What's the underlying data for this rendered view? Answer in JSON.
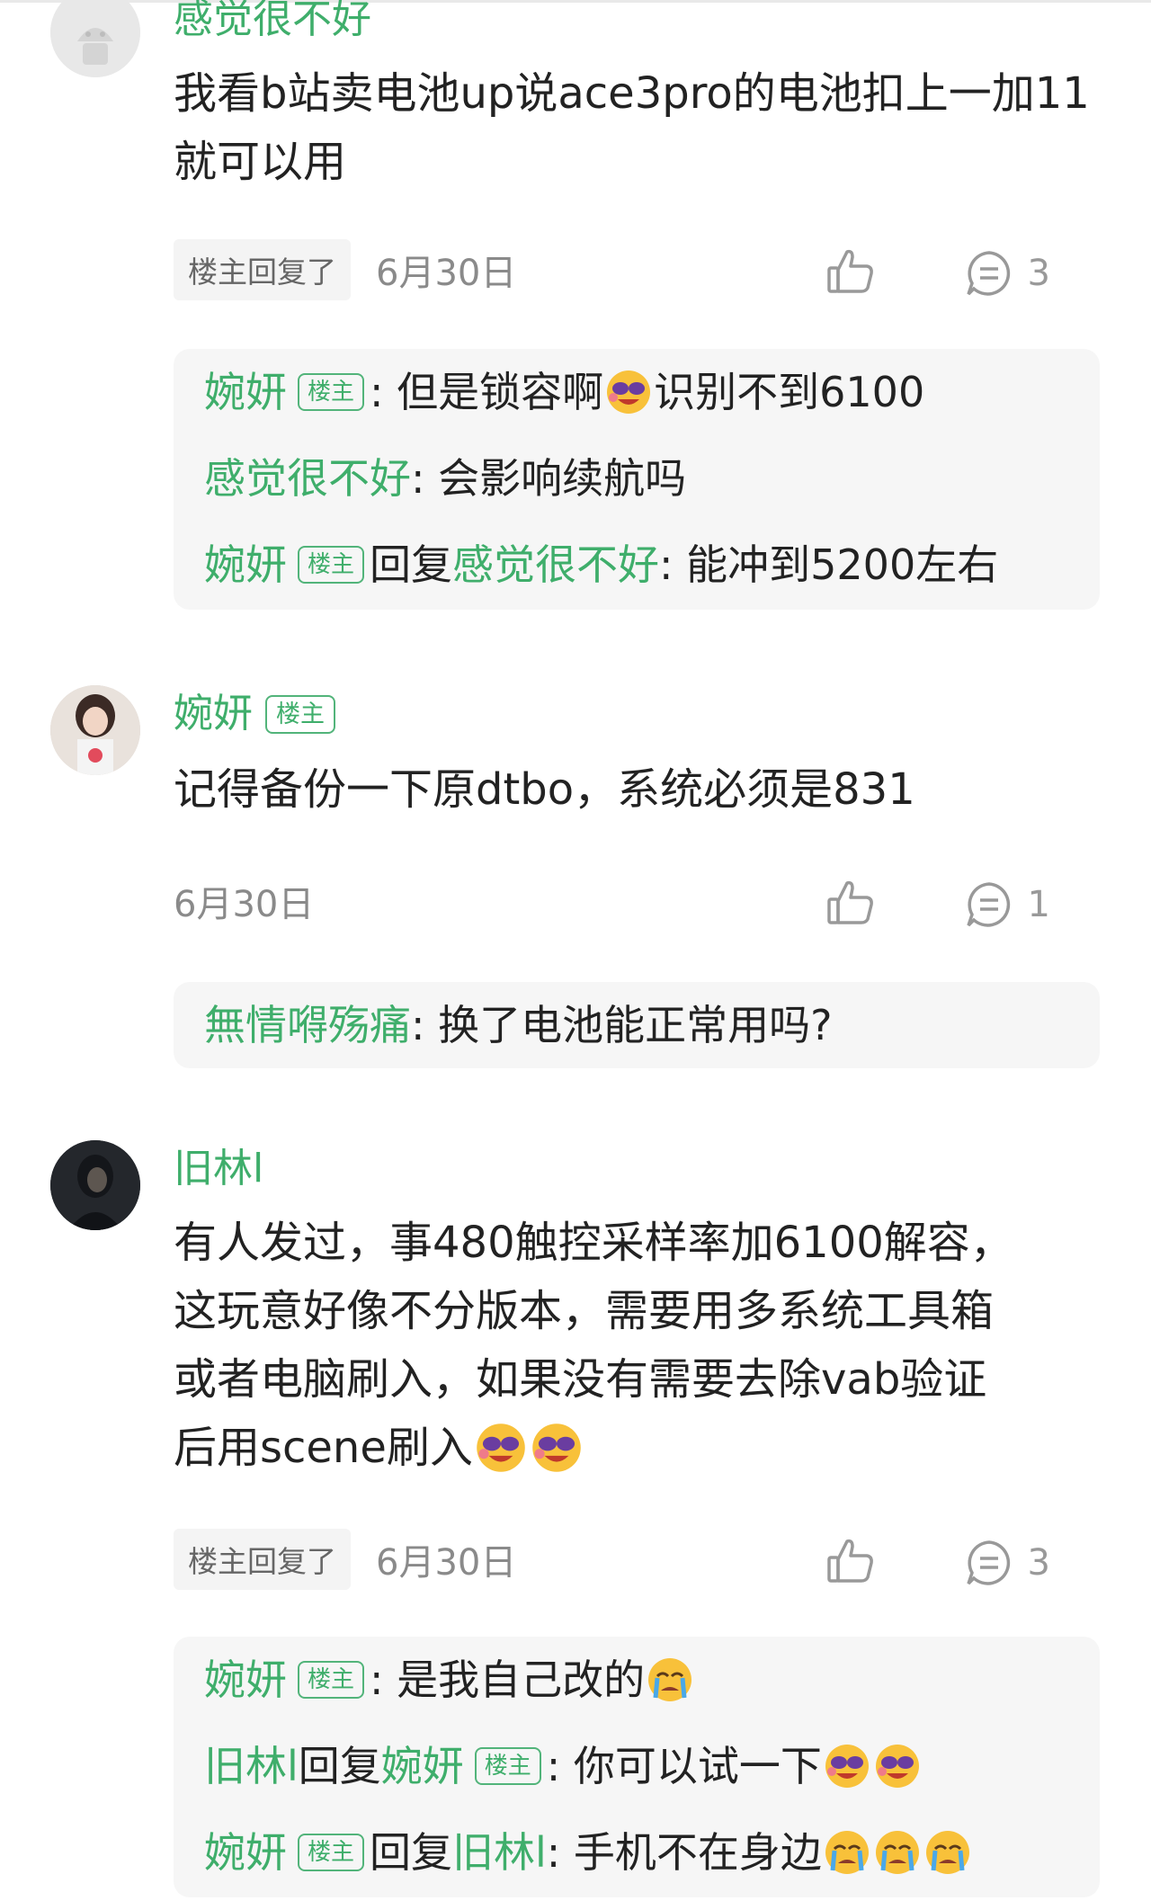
{
  "comments": [
    {
      "username": "感觉很不好",
      "text": "我看b站卖电池up说ace3pro的电池扣上一加11就可以用",
      "op_replied": "楼主回复了",
      "date": "6月30日",
      "reply_count": "3",
      "replies": [
        {
          "user": "婉妍",
          "badge": "楼主",
          "text": "但是锁容啊",
          "text_after": "识别不到6100"
        },
        {
          "user": "感觉很不好",
          "text": "会影响续航吗"
        },
        {
          "user": "婉妍",
          "badge": "楼主",
          "reply_word": "回复",
          "target": "感觉很不好",
          "text": "能冲到5200左右"
        }
      ]
    },
    {
      "username": "婉妍",
      "badge": "楼主",
      "text": "记得备份一下原dtbo，系统必须是831",
      "date": "6月30日",
      "reply_count": "1",
      "replies": [
        {
          "user": "無情嘚殇痛",
          "text": "换了电池能正常用吗?"
        }
      ]
    },
    {
      "username": "旧林l",
      "text_lines": [
        "有人发过，事480触控采样率加6100解容，",
        "这玩意好像不分版本，需要用多系统工具箱",
        "或者电脑刷入，如果没有需要去除vab验证",
        "后用scene刷入"
      ],
      "op_replied": "楼主回复了",
      "date": "6月30日",
      "reply_count": "3",
      "replies": [
        {
          "user": "婉妍",
          "badge": "楼主",
          "text": "是我自己改的"
        },
        {
          "user": "旧林l",
          "reply_word": "回复",
          "target": "婉妍",
          "target_badge": "楼主",
          "text": "你可以试一下"
        },
        {
          "user": "婉妍",
          "badge": "楼主",
          "reply_word": "回复",
          "target": "旧林l",
          "text": "手机不在身边"
        }
      ]
    }
  ],
  "colors": {
    "accent_green": "#3fae6b",
    "reply_bg": "#f6f6f6",
    "text": "#222222",
    "muted": "#8a8a8a"
  },
  "icons": [
    "thumb-up-icon",
    "comment-icon",
    "laughing-emoji",
    "crying-emoji",
    "default-avatar",
    "user-avatar"
  ]
}
